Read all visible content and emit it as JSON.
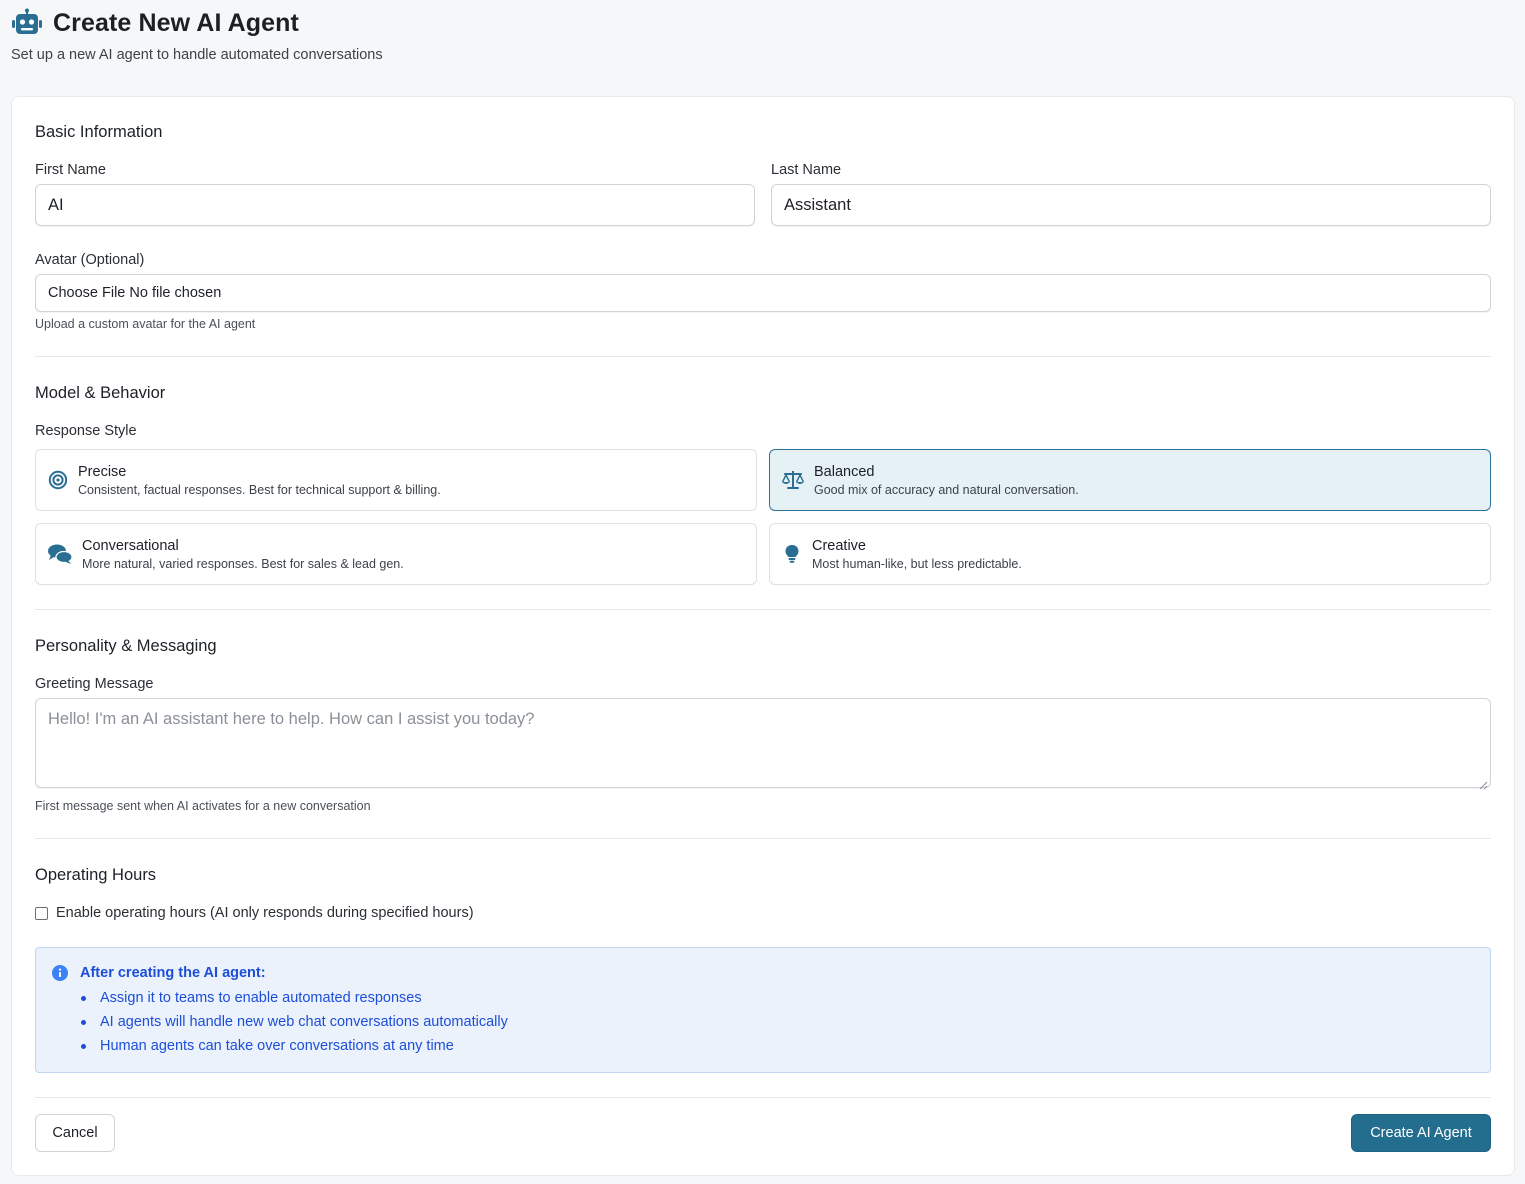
{
  "header": {
    "title": "Create New AI Agent",
    "subtitle": "Set up a new AI agent to handle automated conversations",
    "icon": "robot-icon"
  },
  "basic_info": {
    "section_title": "Basic Information",
    "first_name_label": "First Name",
    "first_name_value": "AI",
    "last_name_label": "Last Name",
    "last_name_value": "Assistant",
    "avatar_label": "Avatar (Optional)",
    "avatar_button": "Choose File",
    "avatar_status": "No file chosen",
    "avatar_help": "Upload a custom avatar for the AI agent"
  },
  "model": {
    "section_title": "Model & Behavior",
    "response_style_label": "Response Style",
    "selected": "Balanced",
    "options": [
      {
        "title": "Precise",
        "description": "Consistent, factual responses. Best for technical support & billing.",
        "icon": "target-icon"
      },
      {
        "title": "Balanced",
        "description": "Good mix of accuracy and natural conversation.",
        "icon": "scale-icon"
      },
      {
        "title": "Conversational",
        "description": "More natural, varied responses. Best for sales & lead gen.",
        "icon": "chat-bubbles-icon"
      },
      {
        "title": "Creative",
        "description": "Most human-like, but less predictable.",
        "icon": "lightbulb-icon"
      }
    ]
  },
  "personality": {
    "section_title": "Personality & Messaging",
    "greeting_label": "Greeting Message",
    "greeting_placeholder": "Hello! I'm an AI assistant here to help. How can I assist you today?",
    "greeting_help": "First message sent when AI activates for a new conversation"
  },
  "hours": {
    "section_title": "Operating Hours",
    "checkbox_label": "Enable operating hours (AI only responds during specified hours)",
    "checked": false
  },
  "info": {
    "title": "After creating the AI agent:",
    "items": [
      "Assign it to teams to enable automated responses",
      "AI agents will handle new web chat conversations automatically",
      "Human agents can take over conversations at any time"
    ]
  },
  "actions": {
    "cancel_label": "Cancel",
    "submit_label": "Create AI Agent"
  },
  "colors": {
    "accent": "#236d8e",
    "selected_bg": "#e6f1f6",
    "info_text": "#1d4ed8",
    "info_bg": "#ebf2fc"
  }
}
